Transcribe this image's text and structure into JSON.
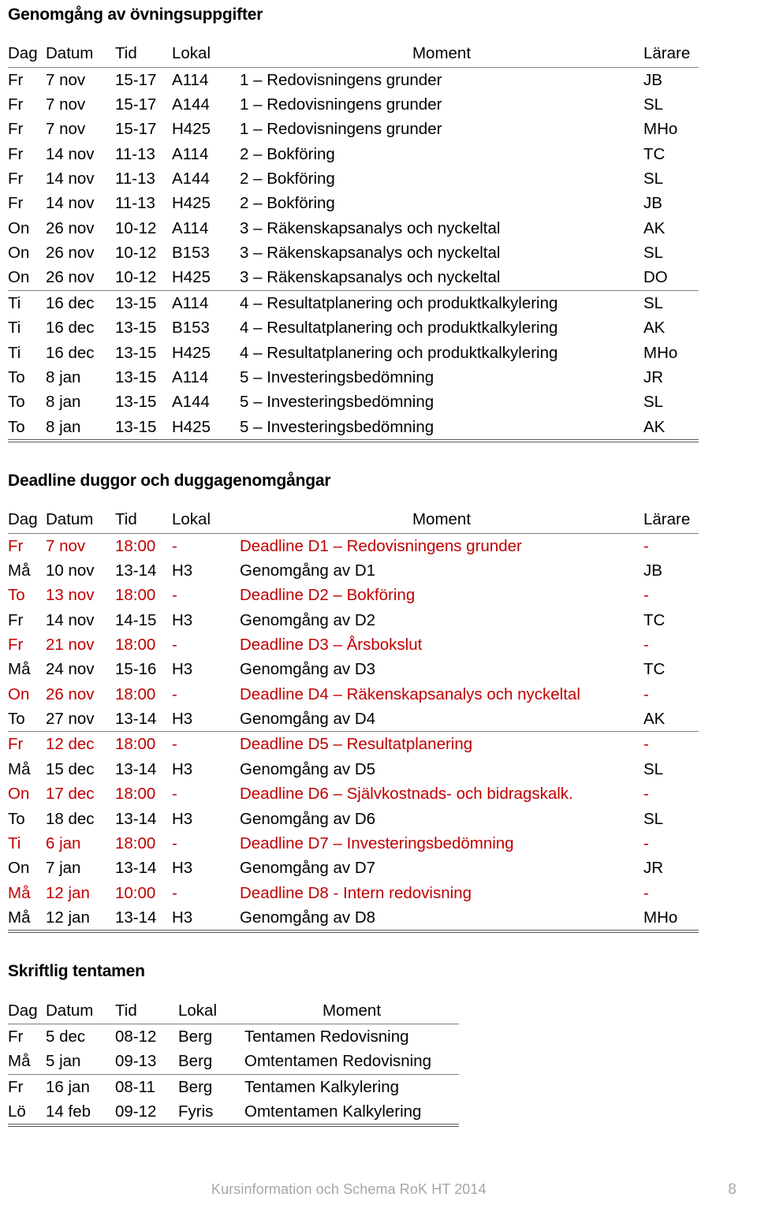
{
  "document": {
    "footer_text": "Kursinformation och Schema RoK HT 2014",
    "page_number": "8",
    "accent_red": "#C00000",
    "footer_color": "#A6A6A6"
  },
  "sections": [
    {
      "title": "Genomgång av övningsuppgifter",
      "columns": [
        "Dag",
        "Datum",
        "Tid",
        "Lokal",
        "Moment",
        "Lärare"
      ],
      "rows": [
        {
          "dag": "Fr",
          "datum": "7 nov",
          "tid": "15-17",
          "lokal": "A114",
          "moment": "1 – Redovisningens grunder",
          "larare": "JB"
        },
        {
          "dag": "Fr",
          "datum": "7 nov",
          "tid": "15-17",
          "lokal": "A144",
          "moment": "1 – Redovisningens grunder",
          "larare": "SL"
        },
        {
          "dag": "Fr",
          "datum": "7 nov",
          "tid": "15-17",
          "lokal": "H425",
          "moment": "1 – Redovisningens grunder",
          "larare": "MHo"
        },
        {
          "dag": "Fr",
          "datum": "14 nov",
          "tid": "11-13",
          "lokal": "A114",
          "moment": "2 – Bokföring",
          "larare": "TC"
        },
        {
          "dag": "Fr",
          "datum": "14 nov",
          "tid": "11-13",
          "lokal": "A144",
          "moment": "2 – Bokföring",
          "larare": "SL"
        },
        {
          "dag": "Fr",
          "datum": "14 nov",
          "tid": "11-13",
          "lokal": "H425",
          "moment": "2 – Bokföring",
          "larare": "JB"
        },
        {
          "dag": "On",
          "datum": "26 nov",
          "tid": "10-12",
          "lokal": "A114",
          "moment": "3 – Räkenskapsanalys och nyckeltal",
          "larare": "AK"
        },
        {
          "dag": "On",
          "datum": "26 nov",
          "tid": "10-12",
          "lokal": "B153",
          "moment": "3 – Räkenskapsanalys och nyckeltal",
          "larare": "SL"
        },
        {
          "dag": "On",
          "datum": "26 nov",
          "tid": "10-12",
          "lokal": "H425",
          "moment": "3 – Räkenskapsanalys och nyckeltal",
          "larare": "DO"
        },
        {
          "dag": "Ti",
          "datum": "16 dec",
          "tid": "13-15",
          "lokal": "A114",
          "moment": "4 – Resultatplanering och produktkalkylering",
          "larare": "SL"
        },
        {
          "dag": "Ti",
          "datum": "16 dec",
          "tid": "13-15",
          "lokal": "B153",
          "moment": "4 – Resultatplanering och produktkalkylering",
          "larare": "AK"
        },
        {
          "dag": "Ti",
          "datum": "16 dec",
          "tid": "13-15",
          "lokal": "H425",
          "moment": "4 – Resultatplanering och produktkalkylering",
          "larare": "MHo"
        },
        {
          "dag": "To",
          "datum": "8 jan",
          "tid": "13-15",
          "lokal": "A114",
          "moment": "5 – Investeringsbedömning",
          "larare": "JR"
        },
        {
          "dag": "To",
          "datum": "8 jan",
          "tid": "13-15",
          "lokal": "A144",
          "moment": "5 – Investeringsbedömning",
          "larare": "SL"
        },
        {
          "dag": "To",
          "datum": "8 jan",
          "tid": "13-15",
          "lokal": "H425",
          "moment": "5 – Investeringsbedömning",
          "larare": "AK"
        }
      ]
    },
    {
      "title": "Deadline duggor och duggagenomgångar",
      "columns": [
        "Dag",
        "Datum",
        "Tid",
        "Lokal",
        "Moment",
        "Lärare"
      ],
      "rows": [
        {
          "dag": "Fr",
          "datum": "7 nov",
          "tid": "18:00",
          "lokal": "-",
          "moment": "Deadline D1 – Redovisningens grunder",
          "larare": "-",
          "red": true
        },
        {
          "dag": "Må",
          "datum": "10 nov",
          "tid": "13-14",
          "lokal": "H3",
          "moment": "Genomgång av D1",
          "larare": "JB",
          "red": false
        },
        {
          "dag": "To",
          "datum": "13 nov",
          "tid": "18:00",
          "lokal": "-",
          "moment": "Deadline D2 – Bokföring",
          "larare": "-",
          "red": true
        },
        {
          "dag": "Fr",
          "datum": "14 nov",
          "tid": "14-15",
          "lokal": "H3",
          "moment": "Genomgång av D2",
          "larare": "TC",
          "red": false
        },
        {
          "dag": "Fr",
          "datum": "21 nov",
          "tid": "18:00",
          "lokal": "-",
          "moment": "Deadline D3 – Årsbokslut",
          "larare": "-",
          "red": true
        },
        {
          "dag": "Må",
          "datum": "24 nov",
          "tid": "15-16",
          "lokal": "H3",
          "moment": "Genomgång av D3",
          "larare": "TC",
          "red": false
        },
        {
          "dag": "On",
          "datum": "26 nov",
          "tid": "18:00",
          "lokal": "-",
          "moment": "Deadline D4 – Räkenskapsanalys och nyckeltal",
          "larare": "-",
          "red": true
        },
        {
          "dag": "To",
          "datum": "27 nov",
          "tid": "13-14",
          "lokal": "H3",
          "moment": "Genomgång av D4",
          "larare": "AK",
          "red": false
        },
        {
          "dag": "Fr",
          "datum": "12 dec",
          "tid": "18:00",
          "lokal": "-",
          "moment": "Deadline D5 – Resultatplanering",
          "larare": "-",
          "red": true
        },
        {
          "dag": "Må",
          "datum": "15 dec",
          "tid": "13-14",
          "lokal": "H3",
          "moment": "Genomgång av D5",
          "larare": "SL",
          "red": false
        },
        {
          "dag": "On",
          "datum": "17 dec",
          "tid": "18:00",
          "lokal": "-",
          "moment": "Deadline D6 – Självkostnads- och bidragskalk.",
          "larare": "-",
          "red": true
        },
        {
          "dag": "To",
          "datum": "18 dec",
          "tid": "13-14",
          "lokal": "H3",
          "moment": "Genomgång av D6",
          "larare": "SL",
          "red": false
        },
        {
          "dag": "Ti",
          "datum": "6 jan",
          "tid": "18:00",
          "lokal": "-",
          "moment": "Deadline D7 – Investeringsbedömning",
          "larare": "-",
          "red": true
        },
        {
          "dag": "On",
          "datum": "7 jan",
          "tid": "13-14",
          "lokal": "H3",
          "moment": "Genomgång av D7",
          "larare": "JR",
          "red": false
        },
        {
          "dag": "Må",
          "datum": "12 jan",
          "tid": "10:00",
          "lokal": "-",
          "moment": "Deadline D8 - Intern redovisning",
          "larare": "-",
          "red": true
        },
        {
          "dag": "Må",
          "datum": "12 jan",
          "tid": "13-14",
          "lokal": "H3",
          "moment": "Genomgång av D8",
          "larare": "MHo",
          "red": false
        }
      ]
    },
    {
      "title": "Skriftlig tentamen",
      "columns": [
        "Dag",
        "Datum",
        "Tid",
        "Lokal",
        "Moment"
      ],
      "rows": [
        {
          "dag": "Fr",
          "datum": "5 dec",
          "tid": "08-12",
          "lokal": "Berg",
          "moment": "Tentamen Redovisning"
        },
        {
          "dag": "Må",
          "datum": "5 jan",
          "tid": "09-13",
          "lokal": "Berg",
          "moment": "Omtentamen Redovisning"
        },
        {
          "dag": "Fr",
          "datum": "16 jan",
          "tid": "08-11",
          "lokal": "Berg",
          "moment": "Tentamen Kalkylering"
        },
        {
          "dag": "Lö",
          "datum": "14 feb",
          "tid": "09-12",
          "lokal": "Fyris",
          "moment": "Omtentamen Kalkylering"
        }
      ]
    }
  ]
}
